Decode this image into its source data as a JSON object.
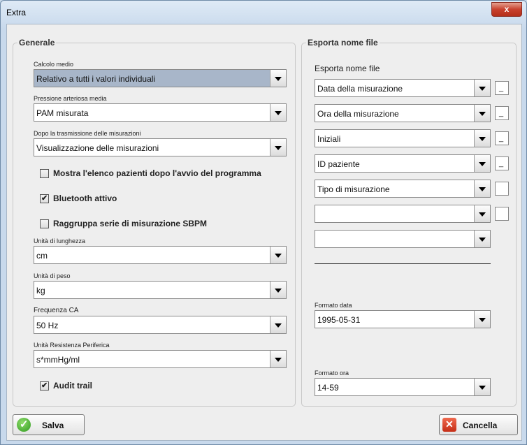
{
  "window": {
    "title": "Extra",
    "close_glyph": "x"
  },
  "generale": {
    "legend": "Generale",
    "calcolo_medio": {
      "label": "Calcolo medio",
      "value": "Relativo a tutti i valori individuali"
    },
    "pressione_media": {
      "label": "Pressione arteriosa media",
      "value": "PAM misurata"
    },
    "dopo_trasmissione": {
      "label": "Dopo la trasmissione delle misurazioni",
      "value": "Visualizzazione delle misurazioni"
    },
    "checkboxes": [
      {
        "label": "Mostra l'elenco pazienti dopo l'avvio del programma",
        "checked": false
      },
      {
        "label": "Bluetooth attivo",
        "checked": true
      },
      {
        "label": "Raggruppa serie di misurazione SBPM",
        "checked": false
      }
    ],
    "unita_lunghezza": {
      "label": "Unità di lunghezza",
      "value": "cm"
    },
    "unita_peso": {
      "label": "Unità di peso",
      "value": "kg"
    },
    "frequenza": {
      "label": "Frequenza CA",
      "value": "50 Hz"
    },
    "resistenza": {
      "label": "Unità Resistenza Periferica",
      "value": "s*mmHg/ml"
    },
    "audit_trail": {
      "label": "Audit trail",
      "checked": true
    },
    "check_glyph": "✔"
  },
  "esporta": {
    "legend": "Esporta nome file",
    "heading": "Esporta nome file",
    "rows": [
      {
        "value": "Data della misurazione",
        "sep": "_"
      },
      {
        "value": "Ora della misurazione",
        "sep": "_"
      },
      {
        "value": "Iniziali",
        "sep": "_"
      },
      {
        "value": "ID paziente",
        "sep": "_"
      },
      {
        "value": "Tipo di misurazione",
        "sep": ""
      },
      {
        "value": "",
        "sep": ""
      },
      {
        "value": ""
      }
    ],
    "formato_data": {
      "label": "Formato data",
      "value": "1995-05-31"
    },
    "formato_ora": {
      "label": "Formato ora",
      "value": "14-59"
    }
  },
  "buttons": {
    "save": "Salva",
    "cancel": "Cancella"
  }
}
